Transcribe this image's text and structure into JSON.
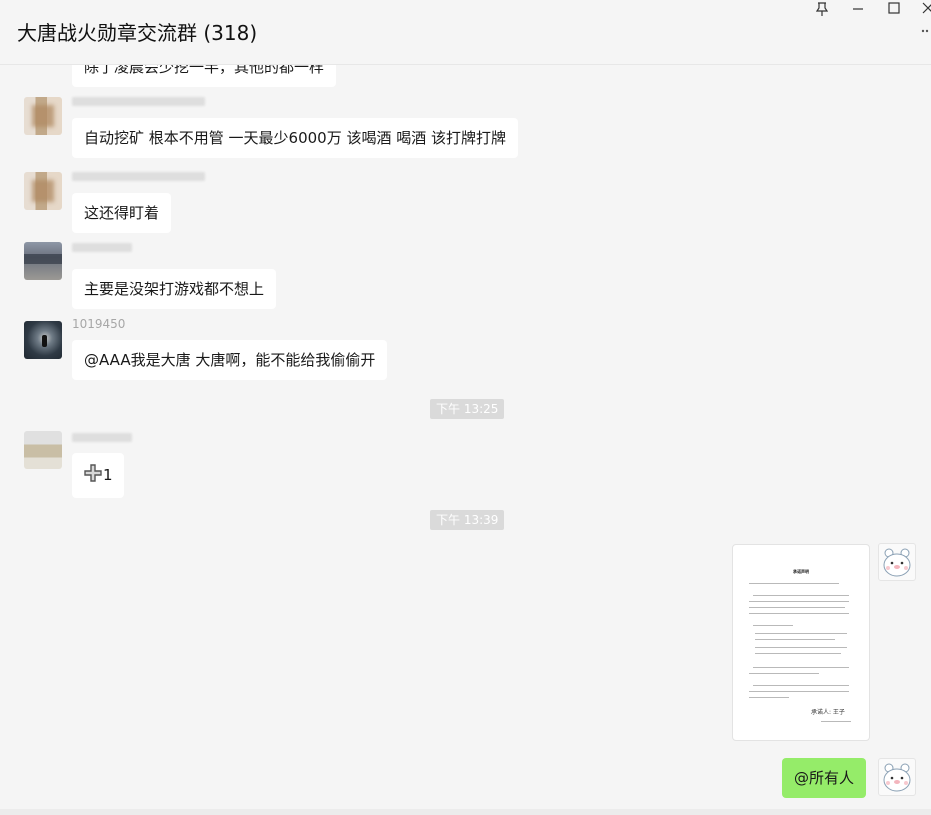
{
  "window": {
    "title": "大唐战火勋章交流群 (318)",
    "pin_icon": "pin-icon",
    "min_icon": "minimize-icon",
    "max_icon": "maximize-icon",
    "close_icon": "close-icon",
    "more_icon": "more-icon"
  },
  "messages": [
    {
      "type": "text",
      "sender_name": "",
      "text": "除了凌晨会少挖一半，其他的都一样"
    },
    {
      "type": "text",
      "sender_name": "",
      "text": "自动挖矿 根本不用管  一天最少6000万  该喝酒 喝酒  该打牌打牌"
    },
    {
      "type": "text",
      "sender_name": "",
      "text": "这还得盯着"
    },
    {
      "type": "text",
      "sender_name": "",
      "text": "主要是没架打游戏都不想上"
    },
    {
      "type": "text",
      "sender_name": "1019450",
      "text": "@AAA我是大唐 大唐啊，能不能给我偷偷开"
    },
    {
      "type": "timestamp",
      "text": "下午 13:25"
    },
    {
      "type": "text",
      "sender_name": "",
      "text": "1",
      "icon": "plus-icon"
    },
    {
      "type": "timestamp",
      "text": "下午 13:39"
    },
    {
      "type": "document",
      "self": true,
      "doc_title": "承诺声明",
      "signature": "承诺人: 王子"
    },
    {
      "type": "text",
      "self": true,
      "text": "@所有人"
    }
  ],
  "colors": {
    "background": "#f5f5f5",
    "bubble_other": "#ffffff",
    "bubble_self": "#95ec69",
    "timestamp_bg": "#dadada"
  }
}
